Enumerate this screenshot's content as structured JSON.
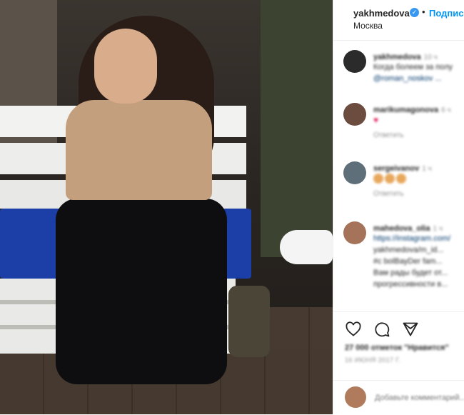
{
  "post": {
    "image_alt": "photo"
  },
  "header": {
    "username": "yakhmedova",
    "verified_glyph": "✓",
    "separator": "•",
    "follow_label": "Подпис",
    "location": "Москва"
  },
  "comments": [
    {
      "username": "yakhmedova",
      "time": "10 ч",
      "lines": [
        "Когда болеем за полу",
        "@roman_noskov ..."
      ],
      "avatar_color": "#2b2b2b"
    },
    {
      "username": "marikumagonova",
      "time": "6 ч",
      "lines": [
        "♥"
      ],
      "reply": "Ответить",
      "avatar_color": "#6b4c3f"
    },
    {
      "username": "sergeivanov",
      "time": "1 ч",
      "lines": [
        "😃😃😃"
      ],
      "reply": "Ответить",
      "avatar_color": "#5e6f7a"
    },
    {
      "username": "mahedova_olia",
      "time": "1 ч",
      "lines": [
        "https://instagram.com/",
        "yakhmedova/m_id...",
        "#c bolBayDer fam...",
        "Вам рады будет от...",
        "прогрессивности в..."
      ],
      "avatar_color": "#a5735a"
    }
  ],
  "actions": {
    "like_icon": "heart-icon",
    "comment_icon": "comment-icon",
    "share_icon": "share-icon",
    "likes_text": "27 000 отметок \"Нравится\"",
    "date_text": "16 ИЮНЯ 2017 Г."
  },
  "add_comment": {
    "placeholder": "Добавьте комментарий...",
    "avatar_color": "#b07a5c"
  }
}
